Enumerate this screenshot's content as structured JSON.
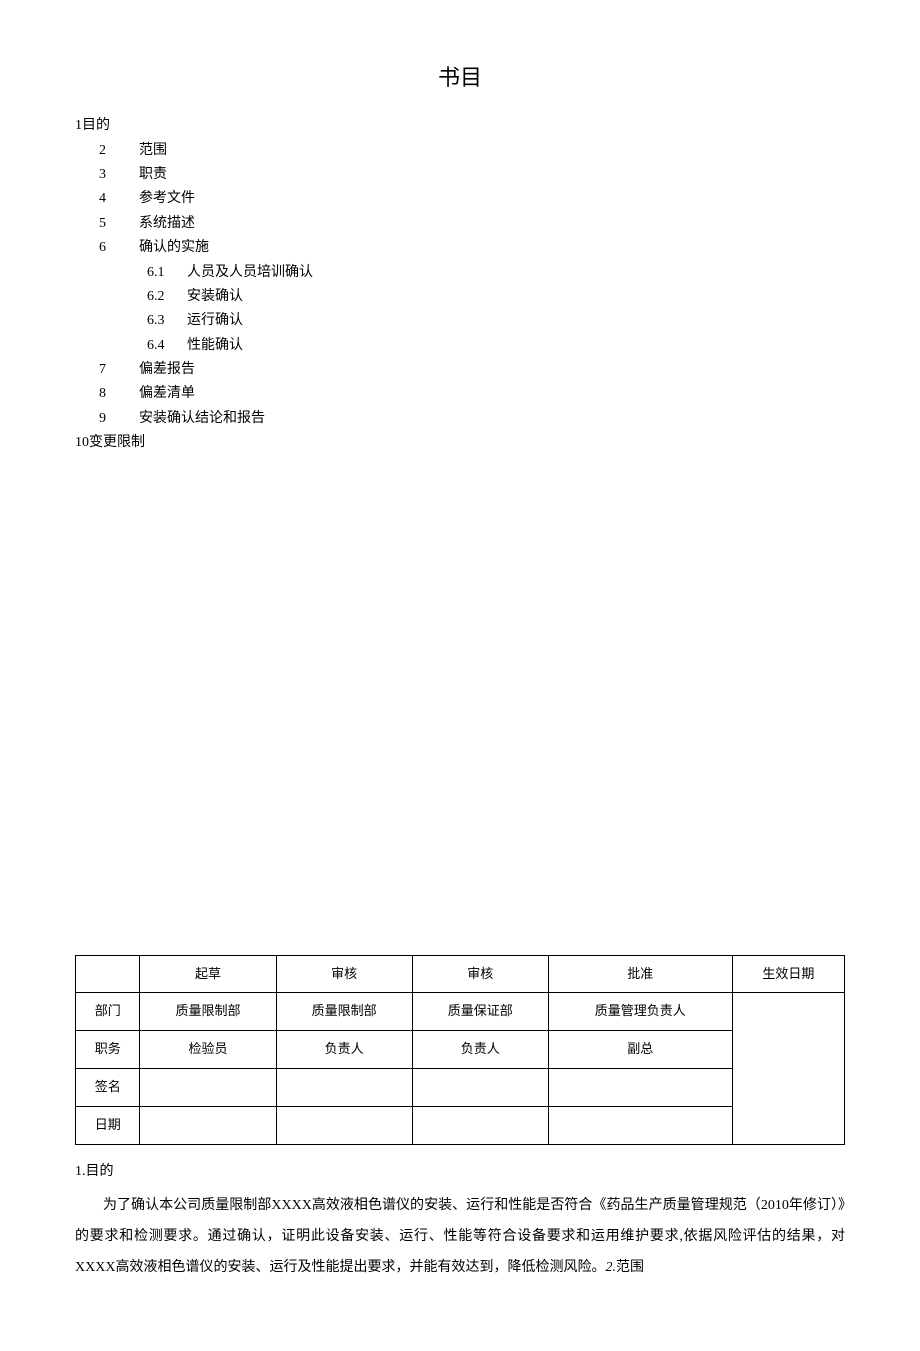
{
  "title": "书目",
  "toc": {
    "i1": "1目的",
    "i2_num": "2",
    "i2_label": "范围",
    "i3_num": "3",
    "i3_label": "职责",
    "i4_num": "4",
    "i4_label": "参考文件",
    "i5_num": "5",
    "i5_label": "系统描述",
    "i6_num": "6",
    "i6_label": "确认的实施",
    "i6_1_num": "6.1",
    "i6_1_label": "人员及人员培训确认",
    "i6_2_num": "6.2",
    "i6_2_label": "安装确认",
    "i6_3_num": "6.3",
    "i6_3_label": "运行确认",
    "i6_4_num": "6.4",
    "i6_4_label": "性能确认",
    "i7_num": "7",
    "i7_label": "偏差报告",
    "i8_num": "8",
    "i8_label": "偏差清单",
    "i9_num": "9",
    "i9_label": "安装确认结论和报告",
    "i10": "10变更限制"
  },
  "table": {
    "h_blank": "",
    "h_draft": "起草",
    "h_review1": "审核",
    "h_review2": "审核",
    "h_approve": "批准",
    "h_effective": "生效日期",
    "r_dept": "部门",
    "r_dept_draft": "质量限制部",
    "r_dept_review1": "质量限制部",
    "r_dept_review2": "质量保证部",
    "r_dept_approve": "质量管理负责人",
    "r_role": "职务",
    "r_role_draft": "检验员",
    "r_role_review1": "负责人",
    "r_role_review2": "负责人",
    "r_role_approve": "副总",
    "r_sign": "签名",
    "r_date": "日期"
  },
  "body": {
    "sec1_h": "1.目的",
    "sec1_p1_a": "为了确认本公司质量限制部XXXX高效液相色谱仪的安装、运行和性能是否符合《药品生产质量管理规范（2010年修订）》的要求和检测要求。通过确认，证明此设备安装、运行、性能等符合设备要求和运用维护要求,依据风险评估的结果，对XXXX高效液相色谱仪的安装、运行及性能提出要求，并能有效达到，降低检测风险。",
    "sec2_inline": "2.",
    "sec2_label": "范围"
  }
}
